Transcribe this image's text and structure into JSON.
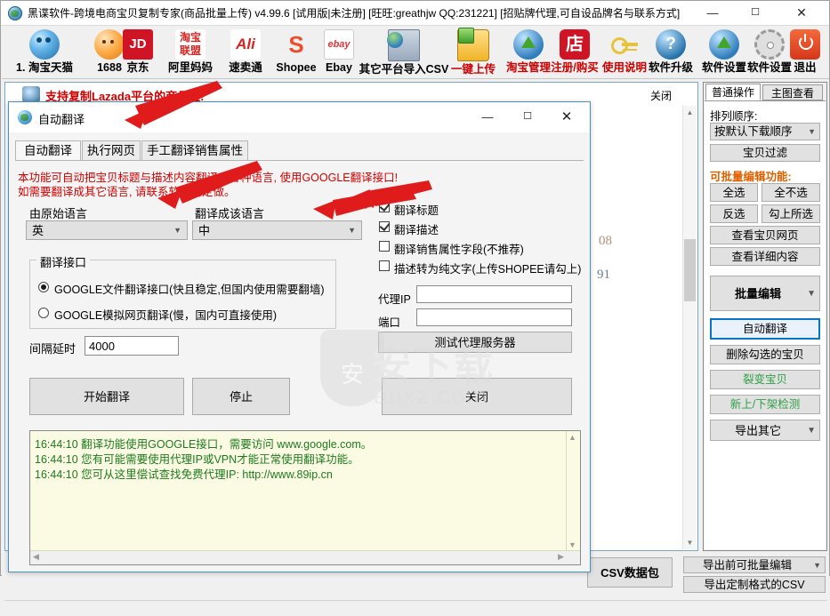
{
  "window": {
    "title": "黑谍软件-跨境电商宝贝复制专家(商品批量上传)  v4.99.6 [试用版|未注册] [旺旺:greathjw QQ:231221] [招贴牌代理,可自设品牌名与联系方式]",
    "minimize": "—",
    "maximize": "☐",
    "close": "✕"
  },
  "toolbar": {
    "items": [
      {
        "label": "1. 淘宝天猫",
        "icon": "taobao-ball-icon",
        "color": "black"
      },
      {
        "label": "1688",
        "icon": "alibaba-ball-icon",
        "color": "black"
      },
      {
        "label": "京东",
        "icon": "jd-icon",
        "color": "black"
      },
      {
        "label": "阿里妈妈",
        "icon": "alimama-icon",
        "color": "black"
      },
      {
        "label": "速卖通",
        "icon": "aliexpress-icon",
        "color": "black"
      },
      {
        "label": "Shopee",
        "icon": "shopee-icon",
        "color": "black"
      },
      {
        "label": "Ebay",
        "icon": "ebay-icon",
        "color": "black"
      },
      {
        "label": "其它平台导入CSV",
        "icon": "monitor-import-icon",
        "color": "black"
      },
      {
        "label": "一键上传",
        "icon": "folder-upload-icon",
        "color": "red"
      },
      {
        "label": "淘宝管理",
        "icon": "store-icon",
        "color": "red"
      },
      {
        "label": "注册/购买",
        "icon": "key-icon",
        "color": "red"
      },
      {
        "label": "使用说明",
        "icon": "help-icon",
        "color": "red"
      },
      {
        "label": "软件升级",
        "icon": "globe-upgrade-icon",
        "color": "black"
      },
      {
        "label": "软件设置",
        "icon": "gear-icon",
        "color": "black"
      },
      {
        "label": "退出",
        "icon": "power-icon",
        "color": "black"
      }
    ]
  },
  "list_panel": {
    "promo_text": "支持复制Lazada平台的商品啦!",
    "promo_close": "关闭",
    "bg_fragment_1": "08",
    "bg_fragment_2": "91"
  },
  "side_panel": {
    "tabs": [
      {
        "label": "普通操作",
        "active": true
      },
      {
        "label": "主图查看",
        "active": false
      }
    ],
    "sort_label": "排列顺序:",
    "sort_value": "按默认下载顺序",
    "filter_button": "宝贝过滤",
    "batch_title": "可批量编辑功能:",
    "buttons": [
      {
        "label": "全选"
      },
      {
        "label": "全不选"
      },
      {
        "label": "反选"
      },
      {
        "label": "勾上所选"
      },
      {
        "label": "查看宝贝网页"
      },
      {
        "label": "查看详细内容"
      }
    ],
    "batch_edit": "批量编辑",
    "auto_translate": "自动翻译",
    "delete_checked": "删除勾选的宝贝",
    "split_item": "裂变宝贝",
    "shelf_check": "新上/下架检测",
    "export_other": "导出其它"
  },
  "bottom": {
    "csv_button": "CSV数据包",
    "export_editable": "导出前可批量编辑",
    "export_custom": "导出定制格式的CSV"
  },
  "dialog": {
    "title": "自动翻译",
    "minimize": "—",
    "maximize": "☐",
    "close": "✕",
    "tabs": [
      {
        "label": "自动翻译",
        "active": true
      },
      {
        "label": "执行网页",
        "active": false
      },
      {
        "label": "手工翻译销售属性",
        "active": false
      }
    ],
    "warning_line1": "本功能可自动把宝贝标题与描述内容翻译成各种语言, 使用GOOGLE翻译接口!",
    "warning_line2": "如需要翻译成其它语言, 请联系软件商定做。",
    "source_label": "由原始语言",
    "source_value": "英",
    "target_label": "翻译成该语言",
    "target_value": "中",
    "group_title": "翻译接口",
    "radio_options": [
      {
        "label": "GOOGLE文件翻译接口(快且稳定,但国内使用需要翻墙)",
        "selected": true
      },
      {
        "label": "GOOGLE模拟网页翻译(慢，国内可直接使用)",
        "selected": false
      }
    ],
    "delay_label": "间隔延时",
    "delay_value": "4000",
    "checkboxes": [
      {
        "label": "翻译标题",
        "checked": true
      },
      {
        "label": "翻译描述",
        "checked": true
      },
      {
        "label": "翻译销售属性字段(不推荐)",
        "checked": false
      },
      {
        "label": "描述转为纯文字(上传SHOPEE请勾上)",
        "checked": false
      }
    ],
    "proxy_ip_label": "代理IP",
    "proxy_ip_value": "",
    "proxy_port_label": "端口",
    "proxy_port_value": "",
    "test_proxy_button": "测试代理服务器",
    "start_button": "开始翻译",
    "stop_button": "停止",
    "close_button": "关闭",
    "log_lines": [
      "16:44:10 翻译功能使用GOOGLE接口，需要访问 www.google.com。",
      "16:44:10 您有可能需要使用代理IP或VPN才能正常使用翻译功能。",
      "16:44:10 您可从这里偿试查找免费代理IP: http://www.89ip.cn"
    ]
  },
  "watermark": {
    "shield_char": "安",
    "main": "安下载",
    "sub": "anxz.com"
  },
  "colors": {
    "accent": "#0a74c4",
    "warning_red": "#d00000",
    "log_green": "#1e7a1e",
    "orange": "#e06000",
    "toolbar_red": "#cc0000"
  }
}
